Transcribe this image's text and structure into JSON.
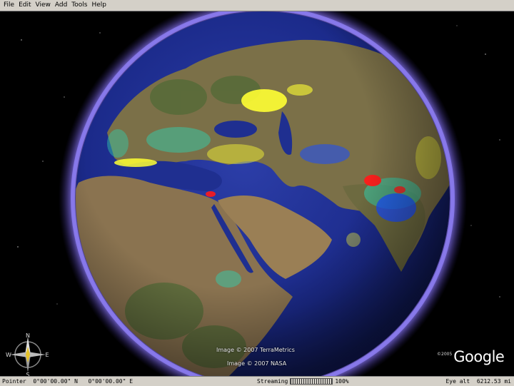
{
  "menu": [
    "File",
    "Edit",
    "View",
    "Add",
    "Tools",
    "Help"
  ],
  "credits": {
    "terrametrics": "Image © 2007 TerraMetrics",
    "nasa": "Image © 2007 NASA"
  },
  "logo": {
    "year": "©2005",
    "name": "Google"
  },
  "compass": {
    "north": "N",
    "south": "S",
    "east": "E",
    "west": "W"
  },
  "status": {
    "pointer_label": "Pointer",
    "latitude": "0°00'00.00\" N",
    "longitude": "0°00'00.00\" E",
    "streaming_label": "Streaming",
    "streaming_percent": "100%",
    "streaming_fraction": 1.0,
    "eye_alt_label": "Eye alt",
    "eye_alt_value": "6212.53 mi"
  },
  "colors": {
    "ocean": "#1b2a8a",
    "atmosphere": "#6a5acd",
    "land": "#7a6a45",
    "data_high": "#ffff33",
    "data_peak": "#ff1a1a",
    "data_low": "#1a4dff",
    "data_mid": "#33ccaa"
  }
}
